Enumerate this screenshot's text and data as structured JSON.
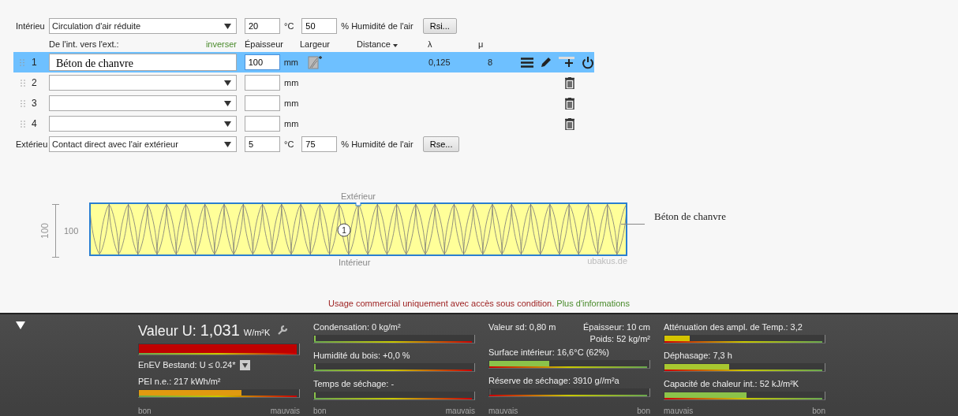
{
  "interior": {
    "label": "Intérieu",
    "condition": "Circulation d'air réduite",
    "temperature": "20",
    "temperature_unit": "°C",
    "humidity": "50",
    "humidity_label": "% Humidité de l'air",
    "button": "Rsi..."
  },
  "header": {
    "direction": "De l'int. vers l'ext.:",
    "reverse": "inverser",
    "thickness": "Épaisseur",
    "width": "Largeur",
    "distance": "Distance",
    "lambda": "λ",
    "mu": "μ"
  },
  "layers": [
    {
      "number": "1",
      "material": "Béton de chanvre",
      "thickness": "100",
      "unit": "mm",
      "lambda": "0,125",
      "mu": "8",
      "selected": true
    },
    {
      "number": "2",
      "unit": "mm",
      "selected": false
    },
    {
      "number": "3",
      "unit": "mm",
      "selected": false
    },
    {
      "number": "4",
      "unit": "mm",
      "selected": false
    }
  ],
  "exterior": {
    "label": "Extérieu",
    "condition": "Contact direct avec l'air extérieur",
    "temperature": "5",
    "temperature_unit": "°C",
    "humidity": "75",
    "humidity_label": "% Humidité de l'air",
    "button": "Rse..."
  },
  "diagram": {
    "top_label": "Extérieur",
    "bottom_label": "Intérieur",
    "dimension_vertical": "100",
    "dimension": "100",
    "layer_marker": "1",
    "credit": "ubakus.de",
    "callout": "Béton de chanvre"
  },
  "notice": {
    "text": "Usage commercial uniquement avec accès sous condition.",
    "link": "Plus d'informations"
  },
  "results": {
    "columns": [
      {
        "reversed": false,
        "scale": [
          "bon",
          "mauvais"
        ],
        "items": [
          {
            "kind": "u_value",
            "label": "Valeur U:",
            "value": "1,031",
            "unit": "W/m²K",
            "level": 1,
            "color": "#c00000",
            "standard": "EnEV Bestand: U ≤ 0.24*"
          },
          {
            "kind": "meter",
            "label": "PEI n.e.: 217 kWh/m²",
            "level": 0.65,
            "color": "#e09a10"
          }
        ]
      },
      {
        "reversed": false,
        "scale": [
          "bon",
          "mauvais"
        ],
        "items": [
          {
            "kind": "meter",
            "label": "Condensation: 0 kg/m²",
            "level": 0,
            "color": "#8bc34a"
          },
          {
            "kind": "meter",
            "label": "Humidité du bois: +0,0 %",
            "level": 0,
            "color": "#8bc34a"
          },
          {
            "kind": "meter",
            "label": "Temps de séchage: -",
            "level": 0,
            "color": "#8bc34a"
          }
        ]
      },
      {
        "reversed": true,
        "scale": [
          "mauvais",
          "bon"
        ],
        "items": [
          {
            "kind": "info",
            "label": "Valeur sd: 0,80 m",
            "notes": [
              "Épaisseur: 10 cm",
              "Poids: 52 kg/m²"
            ]
          },
          {
            "kind": "meter",
            "label": "Surface intérieur: 16,6°C (62%)",
            "level": 0.38,
            "color": "#8bc34a"
          },
          {
            "kind": "meter",
            "label": "Réserve de séchage: 3910 g//m²a",
            "level": 0,
            "color": "#505050"
          }
        ]
      },
      {
        "reversed": true,
        "scale": [
          "mauvais",
          "bon"
        ],
        "items": [
          {
            "kind": "meter",
            "label": "Atténuation des ampl. de Temp.: 3,2",
            "level": 0.16,
            "color": "#d4c400"
          },
          {
            "kind": "meter",
            "label": "Déphasage: 7,3 h",
            "level": 0.41,
            "color": "#a8c830"
          },
          {
            "kind": "meter",
            "label": "Capacité de chaleur int.: 52 kJ/m²K",
            "level": 0.52,
            "color": "#8bc34a"
          }
        ]
      }
    ]
  }
}
